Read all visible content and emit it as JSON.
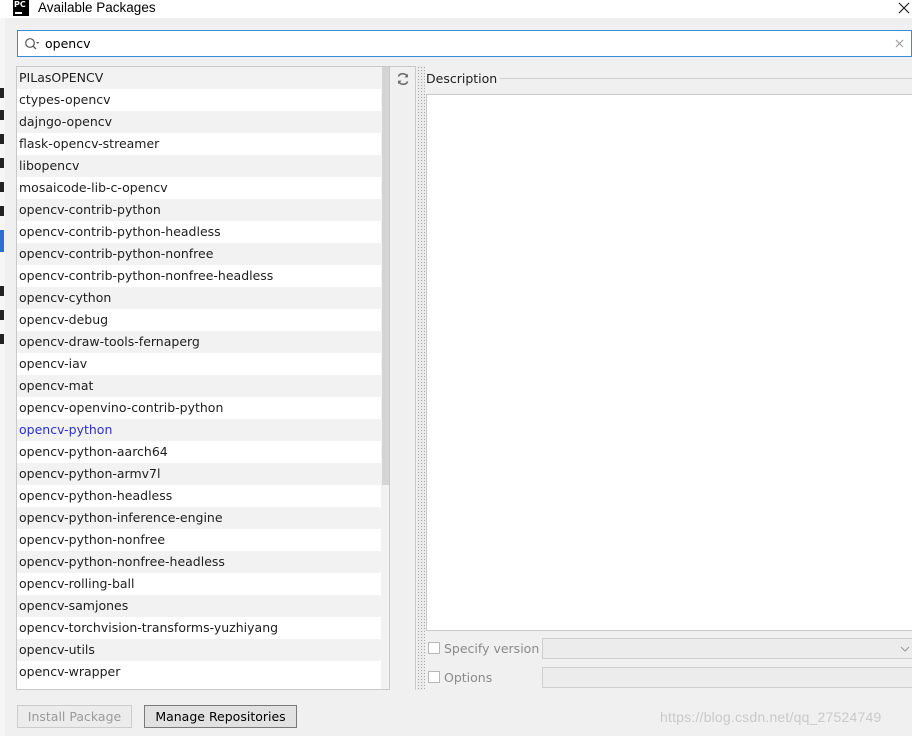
{
  "window": {
    "title": "Available Packages",
    "icon": "pycharm-logo-icon",
    "logo_text": "PC"
  },
  "search": {
    "value": "opencv"
  },
  "packages": {
    "items": [
      "PILasOPENCV",
      "ctypes-opencv",
      "dajngo-opencv",
      "flask-opencv-streamer",
      "libopencv",
      "mosaicode-lib-c-opencv",
      "opencv-contrib-python",
      "opencv-contrib-python-headless",
      "opencv-contrib-python-nonfree",
      "opencv-contrib-python-nonfree-headless",
      "opencv-cython",
      "opencv-debug",
      "opencv-draw-tools-fernaperg",
      "opencv-iav",
      "opencv-mat",
      "opencv-openvino-contrib-python",
      "opencv-python",
      "opencv-python-aarch64",
      "opencv-python-armv7l",
      "opencv-python-headless",
      "opencv-python-inference-engine",
      "opencv-python-nonfree",
      "opencv-python-nonfree-headless",
      "opencv-rolling-ball",
      "opencv-samjones",
      "opencv-torchvision-transforms-yuzhiyang",
      "opencv-utils",
      "opencv-wrapper"
    ],
    "selected_index": 16
  },
  "description": {
    "label": "Description"
  },
  "options": {
    "specify_version_label": "Specify version",
    "options_label": "Options"
  },
  "buttons": {
    "install": "Install Package",
    "manage_repos": "Manage Repositories"
  },
  "watermark": "https://blog.csdn.net/qq_27524749",
  "colors": {
    "accent": "#3d8bd8",
    "selected_text": "#2a33c4"
  }
}
